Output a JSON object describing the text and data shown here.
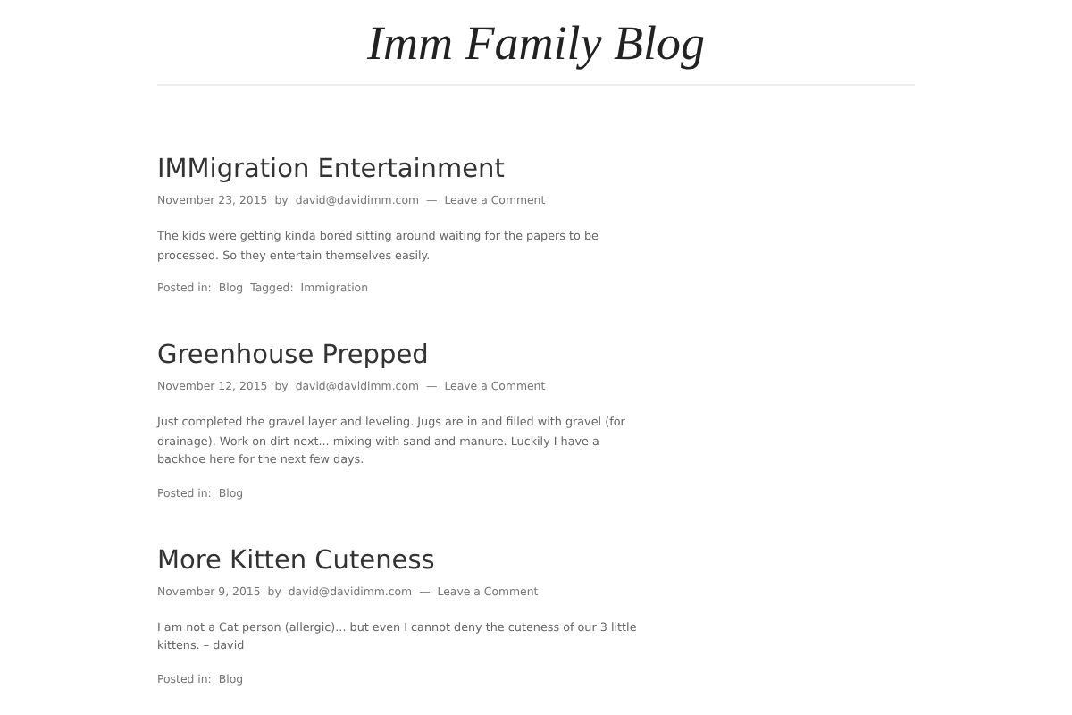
{
  "site": {
    "title": "Imm Family Blog"
  },
  "posts": [
    {
      "title": "IMMigration Entertainment",
      "date": "November 23, 2015",
      "by": "by",
      "author": "david@davidimm.com",
      "separator": "—",
      "comments": "Leave a Comment",
      "body": "The kids were getting kinda bored sitting around waiting for the papers to be processed. So they entertain themselves easily.",
      "posted_in": "Posted in:",
      "category": "Blog",
      "tagged": "Tagged:",
      "tag": "Immigration"
    },
    {
      "title": "Greenhouse Prepped",
      "date": "November 12, 2015",
      "by": "by",
      "author": "david@davidimm.com",
      "separator": "—",
      "comments": "Leave a Comment",
      "body": "Just completed the gravel layer and leveling. Jugs are in and filled with gravel (for drainage). Work on dirt next... mixing with sand and manure.  Luckily I have a backhoe here for the next few days.",
      "posted_in": "Posted in:",
      "category": "Blog"
    },
    {
      "title": "More Kitten Cuteness",
      "date": "November 9, 2015",
      "by": "by",
      "author": "david@davidimm.com",
      "separator": "—",
      "comments": "Leave a Comment",
      "body": "I am not a Cat person (allergic)... but even I cannot deny the cuteness of our 3 little kittens. – david",
      "posted_in": "Posted in:",
      "category": "Blog"
    }
  ]
}
